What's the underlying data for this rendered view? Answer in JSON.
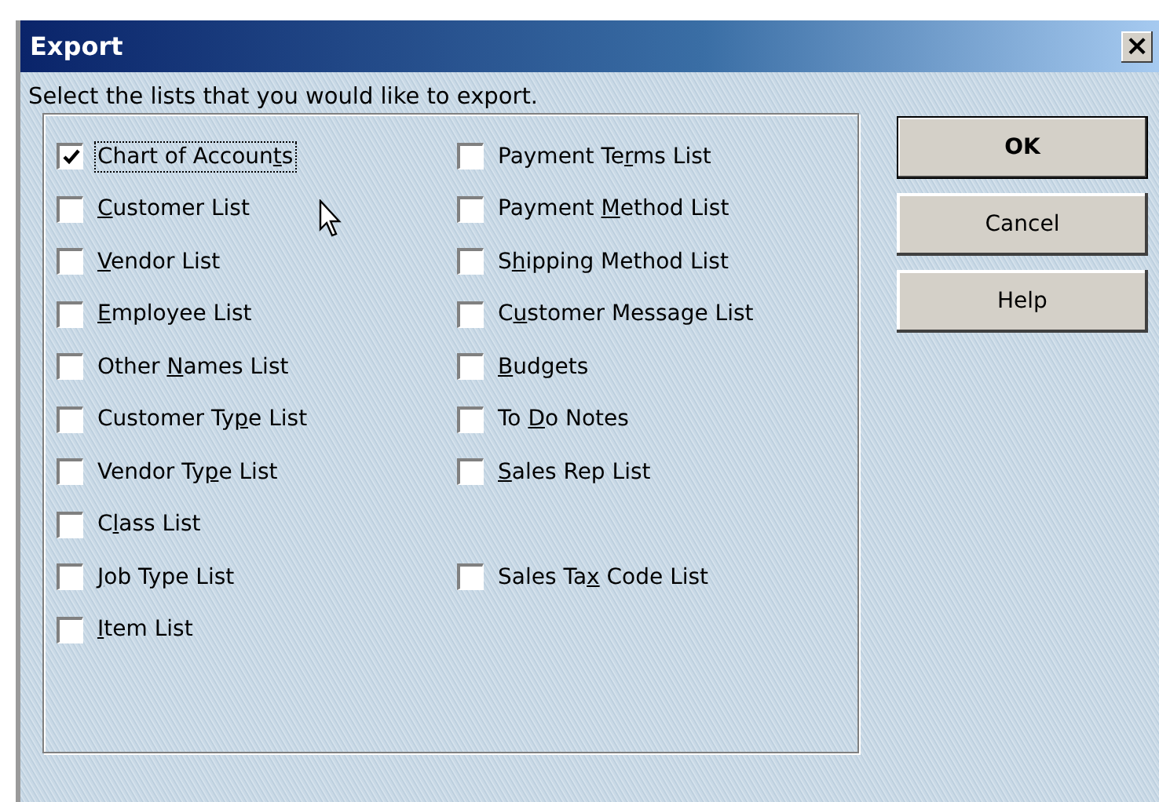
{
  "window": {
    "title": "Export",
    "close": "×"
  },
  "instruction": "Select the lists that you would like to export.",
  "columns": [
    {
      "items": [
        {
          "kind": "checkbox",
          "before": "Chart of Accoun",
          "key": "t",
          "after": "s",
          "checked": true,
          "focused": true
        },
        {
          "kind": "checkbox",
          "key": "C",
          "after": "ustomer List",
          "checked": false,
          "focused": false
        },
        {
          "kind": "checkbox",
          "key": "V",
          "after": "endor List",
          "checked": false,
          "focused": false
        },
        {
          "kind": "checkbox",
          "key": "E",
          "after": "mployee List",
          "checked": false,
          "focused": false
        },
        {
          "kind": "checkbox",
          "before": "Other ",
          "key": "N",
          "after": "ames List",
          "checked": false,
          "focused": false
        },
        {
          "kind": "checkbox",
          "before": "Customer Ty",
          "key": "p",
          "after": "e List",
          "checked": false,
          "focused": false
        },
        {
          "kind": "checkbox",
          "before": "Vendor Ty",
          "key": "p",
          "after": "e List",
          "checked": false,
          "focused": false
        },
        {
          "kind": "checkbox",
          "before": "C",
          "key": "l",
          "after": "ass List",
          "checked": false,
          "focused": false
        },
        {
          "kind": "checkbox",
          "key": "J",
          "after": "ob Type List",
          "checked": false,
          "focused": false
        },
        {
          "kind": "checkbox",
          "key": "I",
          "after": "tem List",
          "checked": false,
          "focused": false
        }
      ]
    },
    {
      "items": [
        {
          "kind": "checkbox",
          "before": "Payment Te",
          "key": "r",
          "after": "ms List",
          "checked": false,
          "focused": false
        },
        {
          "kind": "checkbox",
          "before": "Payment ",
          "key": "M",
          "after": "ethod List",
          "checked": false,
          "focused": false
        },
        {
          "kind": "checkbox",
          "before": "S",
          "key": "h",
          "after": "ipping Method List",
          "checked": false,
          "focused": false
        },
        {
          "kind": "checkbox",
          "before": "C",
          "key": "u",
          "after": "stomer Message List",
          "checked": false,
          "focused": false
        },
        {
          "kind": "checkbox",
          "key": "B",
          "after": "udgets",
          "checked": false,
          "focused": false
        },
        {
          "kind": "checkbox",
          "before": "To ",
          "key": "D",
          "after": "o Notes",
          "checked": false,
          "focused": false
        },
        {
          "kind": "checkbox",
          "key": "S",
          "after": "ales Rep List",
          "checked": false,
          "focused": false
        },
        {
          "kind": "blank"
        },
        {
          "kind": "checkbox",
          "before": "Sales Ta",
          "key": "x",
          "after": " Code List",
          "checked": false,
          "focused": false
        }
      ]
    }
  ],
  "buttons": [
    {
      "label": "OK",
      "default": true
    },
    {
      "label": "Cancel",
      "default": false
    },
    {
      "label": "Help",
      "default": false
    }
  ]
}
